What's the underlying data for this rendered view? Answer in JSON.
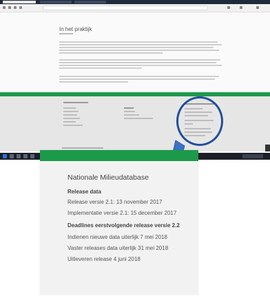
{
  "page": {
    "title": "In het praktijk"
  },
  "card": {
    "title": "Nationale Milieudatabase",
    "release_heading": "Release data",
    "release_items": [
      "Release versie 2.1: 13 november 2017",
      "Implementatie versie 2.1: 15 december 2017"
    ],
    "deadline_heading": "Deadlines eerstvolgende release versie 2.2",
    "deadline_items": [
      "Indienen nieuwe data uiterlijk 7 mei 2018",
      "Vaster releases data uiterlijk 31 mei 2018",
      "Uitleveren release 4 juni 2018"
    ]
  },
  "colors": {
    "brand_green": "#1c9a4a",
    "magnifier_blue": "#1f4e9b",
    "taskbar": "#1b1f27"
  },
  "icons": [
    "magnifier-icon",
    "browser-tab-icon",
    "start-icon"
  ]
}
